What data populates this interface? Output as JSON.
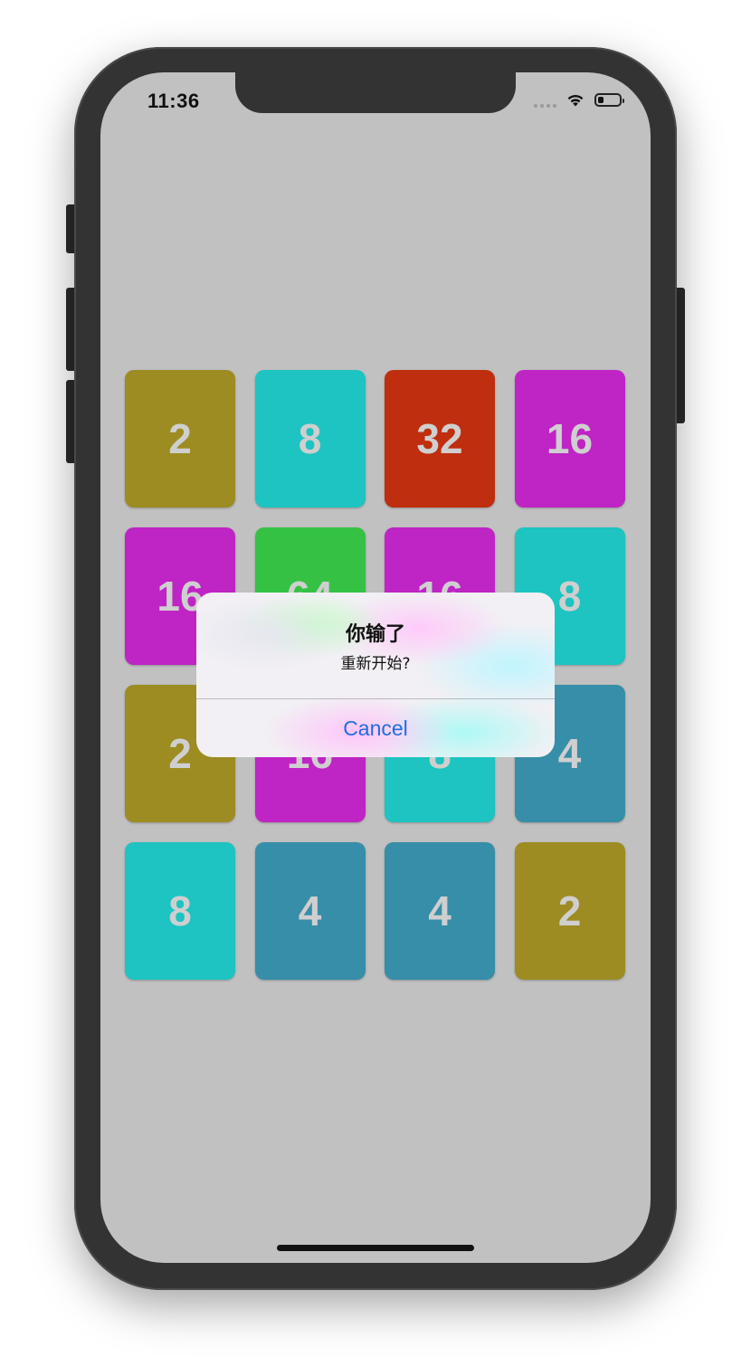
{
  "status_bar": {
    "time": "11:36",
    "signal_icon": "signal-dots-icon",
    "wifi_icon": "wifi-icon",
    "battery_icon": "battery-icon",
    "battery_level": 0.25
  },
  "board": {
    "rows": [
      [
        {
          "value": "2",
          "color": "#9c8c22"
        },
        {
          "value": "8",
          "color": "#1dc4c1"
        },
        {
          "value": "32",
          "color": "#bf2e0e"
        },
        {
          "value": "16",
          "color": "#bf24c4"
        }
      ],
      [
        {
          "value": "16",
          "color": "#bf24c4"
        },
        {
          "value": "64",
          "color": "#35c244"
        },
        {
          "value": "16",
          "color": "#bf24c4"
        },
        {
          "value": "8",
          "color": "#1dc4c1"
        }
      ],
      [
        {
          "value": "2",
          "color": "#9c8c22"
        },
        {
          "value": "16",
          "color": "#bf24c4"
        },
        {
          "value": "8",
          "color": "#1dc4c1"
        },
        {
          "value": "4",
          "color": "#378ea8"
        }
      ],
      [
        {
          "value": "8",
          "color": "#1dc4c1"
        },
        {
          "value": "4",
          "color": "#378ea8"
        },
        {
          "value": "4",
          "color": "#378ea8"
        },
        {
          "value": "2",
          "color": "#9c8c22"
        }
      ]
    ]
  },
  "alert": {
    "title": "你输了",
    "message": "重新开始?",
    "cancel_label": "Cancel",
    "button_color": "#1f6fe0"
  },
  "screen_background": "#c1c1c1"
}
